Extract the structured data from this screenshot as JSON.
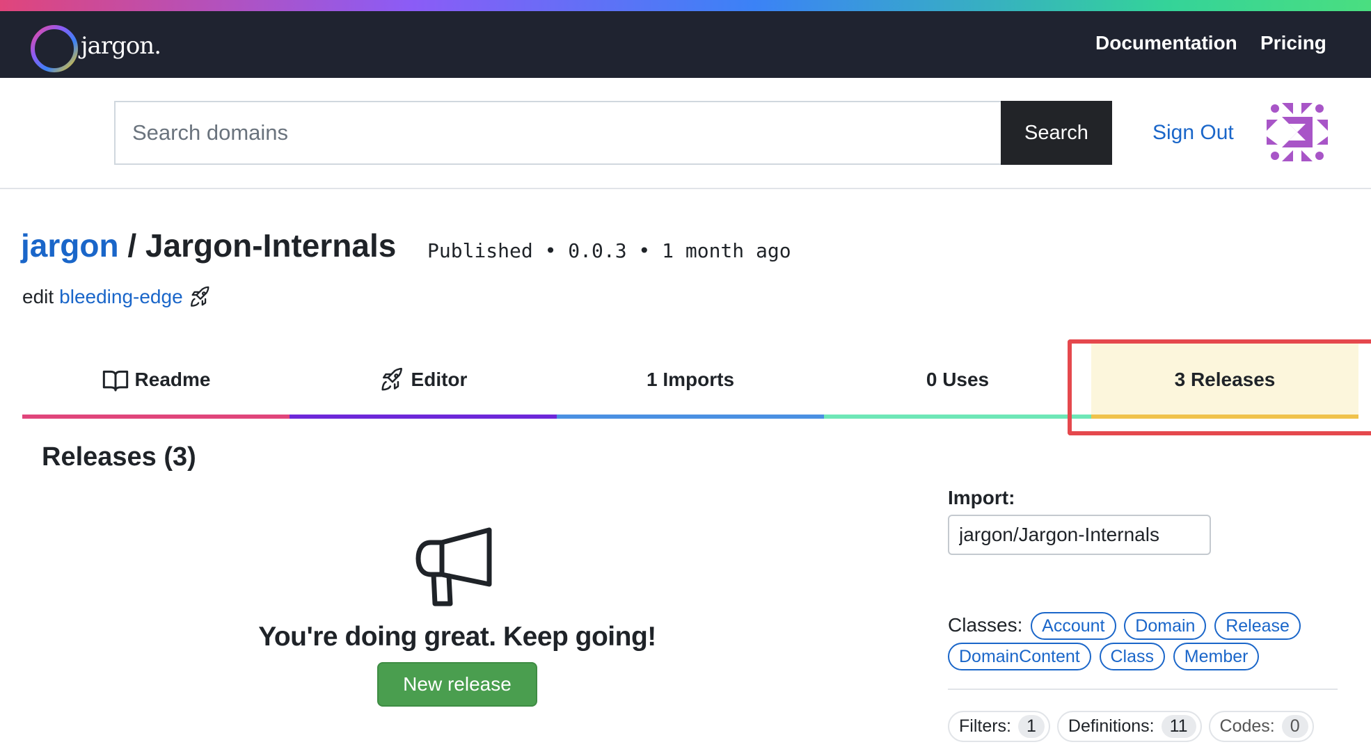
{
  "brand": {
    "name": "jargon."
  },
  "nav": {
    "documentation": "Documentation",
    "pricing": "Pricing"
  },
  "search": {
    "placeholder": "Search domains",
    "button": "Search"
  },
  "account": {
    "sign_out": "Sign Out"
  },
  "domain": {
    "owner": "jargon",
    "separator": "/",
    "name": "Jargon-Internals",
    "meta": "Published • 0.0.3 • 1 month ago",
    "edit_prefix": "edit",
    "branch": "bleeding-edge"
  },
  "tabs": [
    {
      "label": "Readme",
      "icon": "book-icon",
      "color": "#e0457b"
    },
    {
      "label": "Editor",
      "icon": "rocket-icon",
      "color": "#6d28d9"
    },
    {
      "label": "1 Imports",
      "color": "#4a90e2"
    },
    {
      "label": "0 Uses",
      "color": "#6ee7b7"
    },
    {
      "label": "3 Releases",
      "color": "#f0c24b",
      "active": true
    }
  ],
  "releases": {
    "title": "Releases (3)",
    "empty_icon": "megaphone-icon",
    "empty_message": "You're doing great. Keep going!",
    "new_release": "New release"
  },
  "sidebar": {
    "import_label": "Import:",
    "import_value": "jargon/Jargon-Internals",
    "classes_label": "Classes:",
    "classes": [
      "Account",
      "Domain",
      "Release",
      "DomainContent",
      "Class",
      "Member"
    ],
    "counters": [
      {
        "label": "Filters:",
        "value": "1"
      },
      {
        "label": "Definitions:",
        "value": "11"
      },
      {
        "label": "Codes:",
        "value": "0"
      }
    ]
  },
  "colors": {
    "link": "#1a66c9",
    "navbar": "#1f2330",
    "highlight": "#e5484d",
    "active_tab_bg": "#fcf6dc",
    "success": "#4a9e4f"
  }
}
